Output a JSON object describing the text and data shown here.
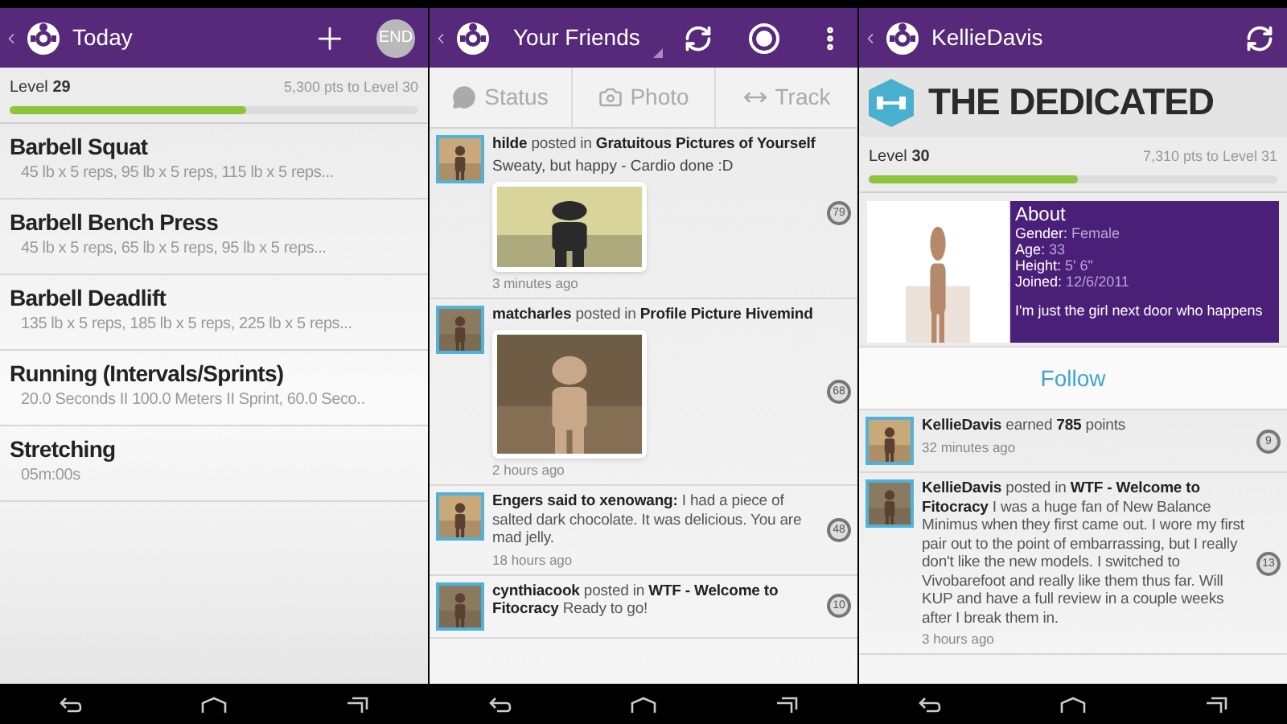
{
  "screens": [
    {
      "kind": "workout",
      "header": {
        "title": "Today",
        "actions": [
          {
            "kind": "plus"
          },
          {
            "kind": "end",
            "label": "END"
          }
        ]
      },
      "progress": {
        "label": "Level",
        "value": "29",
        "to_next": "5,300 pts to Level 30",
        "level": 0.58
      },
      "exercises": [
        {
          "name": "Barbell Squat",
          "detail": "45 lb x 5 reps, 95 lb x 5 reps, 115 lb x 5 reps..."
        },
        {
          "name": "Barbell Bench Press",
          "detail": "45 lb x 5 reps, 65 lb x 5 reps, 95 lb x 5 reps..."
        },
        {
          "name": "Barbell Deadlift",
          "detail": "135 lb x 5 reps, 185 lb x 5 reps, 225 lb x 5 reps..."
        },
        {
          "name": "Running (Intervals/Sprints)",
          "detail": "20.0 Seconds II 100.0 Meters II Sprint, 60.0 Seco.."
        },
        {
          "name": "Stretching",
          "detail": "05m:00s"
        }
      ]
    },
    {
      "kind": "feed",
      "header": {
        "title": "Your Friends",
        "actions": [
          {
            "kind": "refresh"
          },
          {
            "kind": "record"
          },
          {
            "kind": "more"
          }
        ]
      },
      "tabs": [
        {
          "kind": "status",
          "label": "Status"
        },
        {
          "label": "Photo"
        },
        {
          "kind": "track",
          "label": "Track"
        }
      ],
      "posts": [
        {
          "headline": "**hilde** posted in **Gratuitous Pictures of Yourself**",
          "message": "Sweaty, but happy - Cardio done :D",
          "time": "3 minutes ago",
          "count": "79"
        },
        {
          "headline": "**matcharles** posted in **Profile Picture Hivemind**",
          "time": "2 hours ago",
          "count": "68"
        },
        {
          "kind": "text",
          "headline": "**Engers said to xenowang:** I had a piece of salted dark chocolate. It was delicious. You are mad jelly.",
          "time": "18 hours ago",
          "count": "48"
        },
        {
          "kind": "text",
          "headline": "**cynthiacook** posted in **WTF - Welcome to Fitocracy** Ready to go!",
          "count": "10"
        }
      ]
    },
    {
      "kind": "profile",
      "header": {
        "title": "KellieDavis",
        "actions": [
          {
            "kind": "refresh"
          }
        ]
      },
      "banner": {
        "title": "THE DEDICATED"
      },
      "progress": {
        "label": "Level",
        "value": "30",
        "to_next": "7,310 pts to Level 31",
        "level": 0.51
      },
      "about": {
        "title": "About",
        "fields": [
          {
            "label": "Gender:",
            "value": "Female"
          },
          {
            "label": "Age:",
            "value": "33"
          },
          {
            "label": "Height:",
            "value": "5' 6\""
          },
          {
            "label": "Joined:",
            "value": "12/6/2011"
          }
        ],
        "bio": "I'm just the girl next door who happens"
      },
      "follow_button": "Follow",
      "posts": [
        {
          "kind": "text",
          "headline": "**KellieDavis** earned **785** points",
          "time": "32 minutes ago",
          "count": "9"
        },
        {
          "kind": "text",
          "headline": "**KellieDavis** posted in **WTF - Welcome to Fitocracy** I was a huge fan of New Balance Minimus when they first came out. I wore my first pair out to the point of embarrassing, but I really don't like the new models. I switched to Vivobarefoot and really like them thus far. Will KUP and have a full review in a couple weeks after I break them in.",
          "time": "3 hours ago",
          "count": "13"
        }
      ]
    }
  ]
}
